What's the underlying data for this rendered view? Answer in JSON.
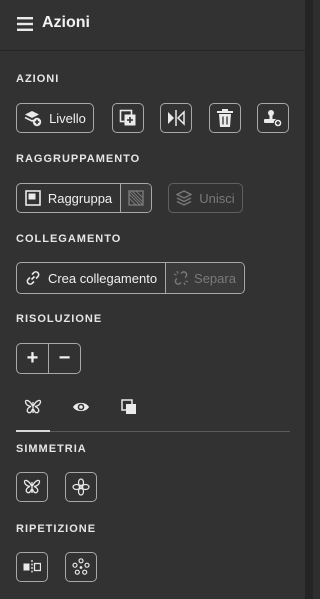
{
  "header": {
    "title": "Azioni",
    "icon": "hamburger-menu-icon"
  },
  "sections": {
    "azioni": {
      "label": "AZIONI",
      "livello_label": "Livello",
      "icons": [
        "layer-add-icon",
        "duplicate-icon",
        "mirror-icon",
        "trash-icon",
        "stamp-icon"
      ]
    },
    "raggruppamento": {
      "label": "RAGGRUPPAMENTO",
      "raggruppa_label": "Raggruppa",
      "unisci_label": "Unisci"
    },
    "collegamento": {
      "label": "COLLEGAMENTO",
      "crea_label": "Crea collegamento",
      "separa_label": "Separa"
    },
    "risoluzione": {
      "label": "RISOLUZIONE",
      "increase_label": "+",
      "decrease_label": "−"
    },
    "simmetria": {
      "label": "SIMMETRIA"
    },
    "ripetizione": {
      "label": "RIPETIZIONE"
    }
  },
  "tabs": [
    "butterfly-icon",
    "eye-icon",
    "layers-icon"
  ],
  "colors": {
    "panel": "#323232",
    "border": "#a8a8a8",
    "disabled": "#7a7a7a",
    "text": "#f0f0f0"
  }
}
